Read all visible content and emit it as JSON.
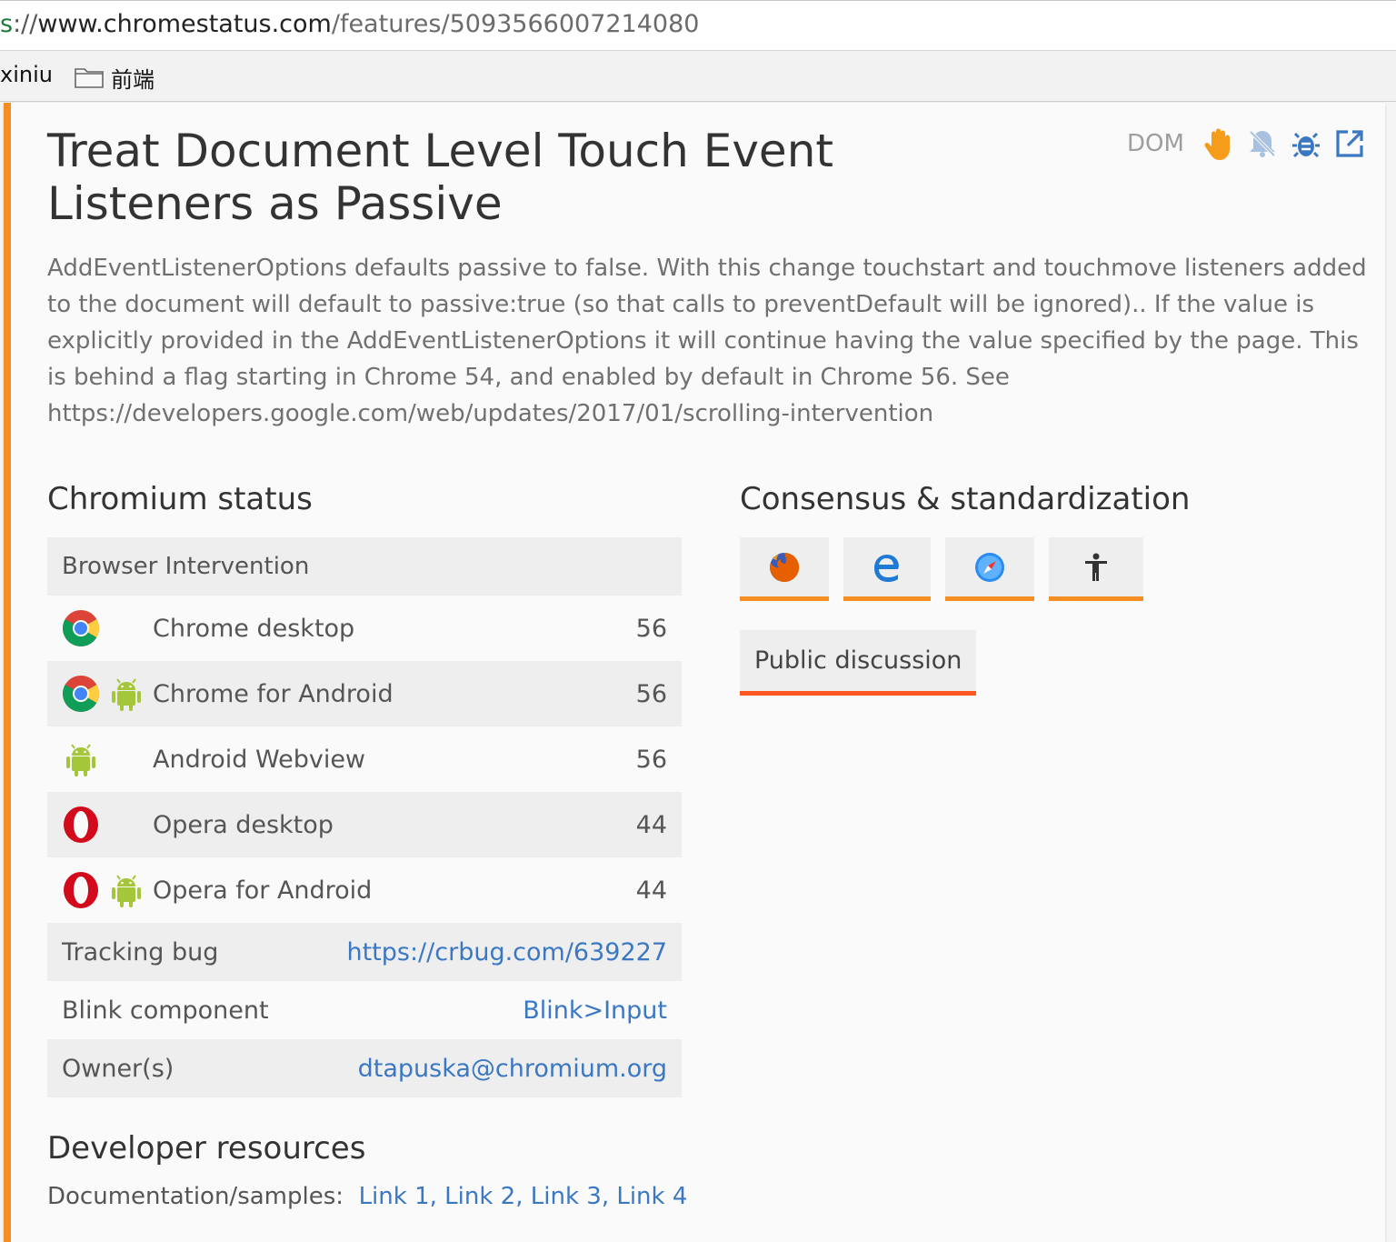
{
  "browser": {
    "url": {
      "scheme": "s",
      "sep": "://",
      "host": "www.chromestatus.com",
      "path": "/features/5093566007214080"
    },
    "bookmarks": [
      {
        "label": "xiniu"
      },
      {
        "label": "前端",
        "icon": "folder-icon"
      }
    ]
  },
  "feature": {
    "title": "Treat Document Level Touch Event Listeners as Passive",
    "category": "DOM",
    "action_icons": [
      "intervention-hand-icon",
      "bell-off-icon",
      "bug-icon",
      "open-external-icon"
    ],
    "summary": "AddEventListenerOptions defaults passive to false. With this change touchstart and touchmove listeners added to the document will default to passive:true (so that calls to preventDefault will be ignored)..  If the value is explicitly provided in the AddEventListenerOptions it will continue having the value specified by the page.  This is behind a flag starting in Chrome 54, and enabled by default in Chrome 56. See https://developers.google.com/web/updates/2017/01/scrolling-intervention"
  },
  "chromium_status": {
    "heading": "Chromium status",
    "status": "Browser Intervention",
    "browsers": [
      {
        "name": "Chrome desktop",
        "version": "56",
        "icons": [
          "chrome-icon"
        ]
      },
      {
        "name": "Chrome for Android",
        "version": "56",
        "icons": [
          "chrome-icon",
          "android-icon"
        ]
      },
      {
        "name": "Android Webview",
        "version": "56",
        "icons": [
          "android-icon"
        ]
      },
      {
        "name": "Opera desktop",
        "version": "44",
        "icons": [
          "opera-icon"
        ]
      },
      {
        "name": "Opera for Android",
        "version": "44",
        "icons": [
          "opera-icon",
          "android-icon"
        ]
      }
    ],
    "details": [
      {
        "label": "Tracking bug",
        "value": "https://crbug.com/639227"
      },
      {
        "label": "Blink component",
        "value": "Blink>Input"
      },
      {
        "label": "Owner(s)",
        "value": "dtapuska@chromium.org"
      }
    ]
  },
  "developer_resources": {
    "heading": "Developer resources",
    "label": "Documentation/samples:",
    "links": [
      "Link 1",
      "Link 2",
      "Link 3",
      "Link 4"
    ]
  },
  "consensus": {
    "heading": "Consensus & standardization",
    "vendors": [
      "firefox-icon",
      "edge-icon",
      "safari-icon",
      "accessibility-icon"
    ],
    "public_discussion": "Public discussion"
  },
  "colors": {
    "accent": "#f58f23",
    "link": "#3b78c3",
    "discussion_underline": "#ff5722",
    "android": "#a4c639"
  }
}
